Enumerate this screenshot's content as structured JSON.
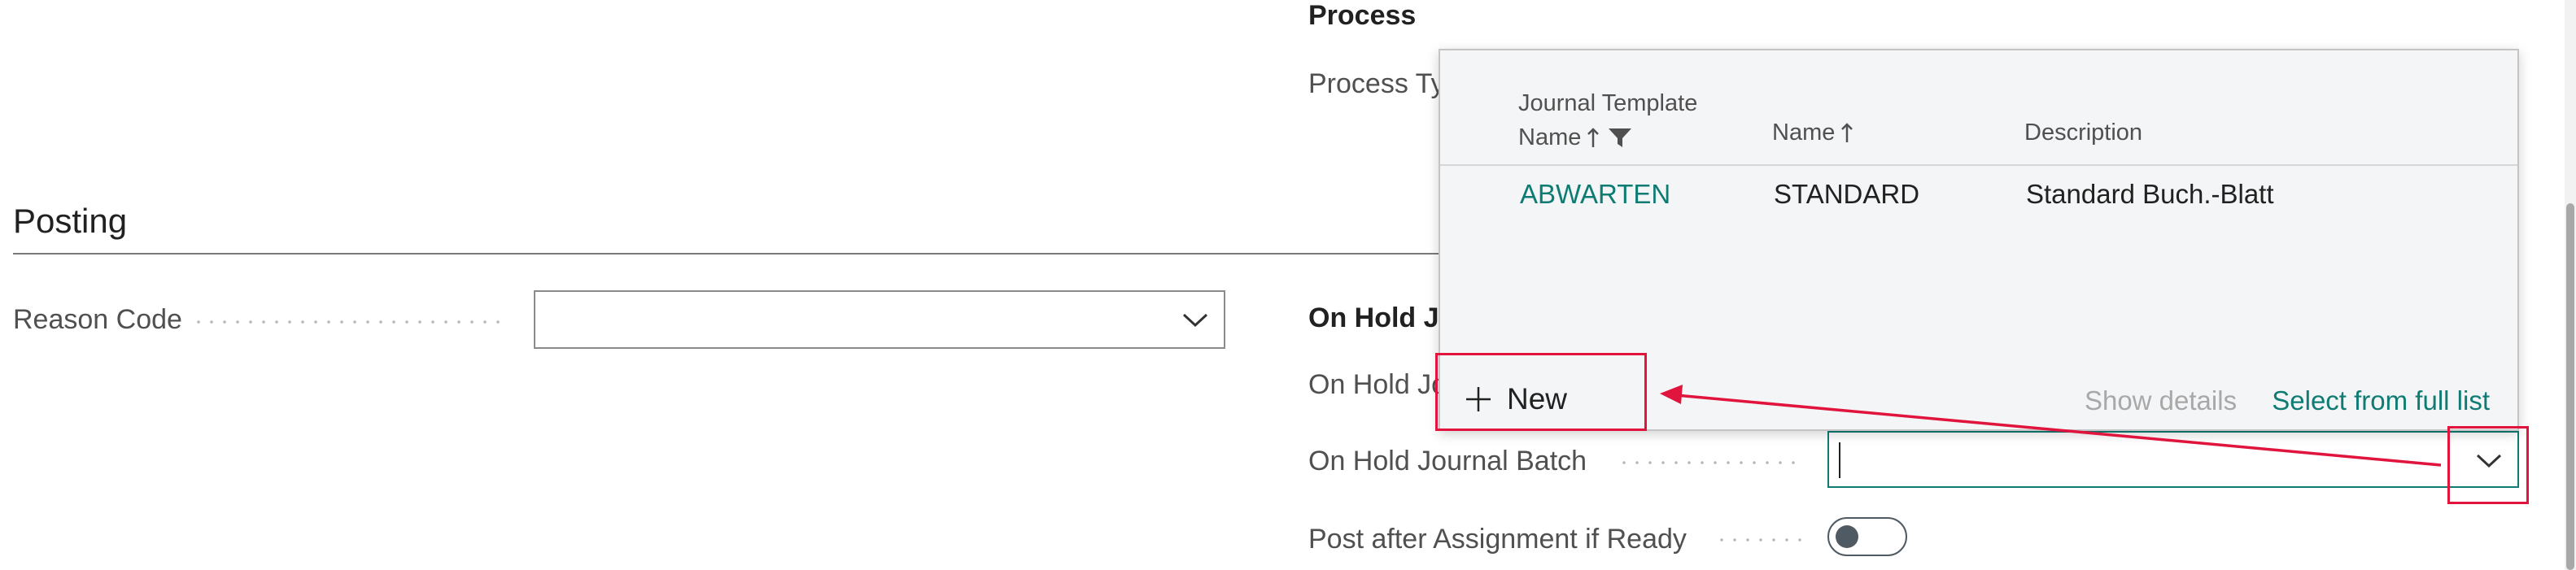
{
  "process": {
    "heading": "Process",
    "process_type_label": "Process Ty"
  },
  "posting": {
    "heading": "Posting",
    "reason_code_label": "Reason Code",
    "reason_code_value": ""
  },
  "on_hold": {
    "heading": "On Hold Jo",
    "template_label": "On Hold Jo",
    "batch_label": "On Hold Journal Batch",
    "batch_value": "",
    "post_after_label": "Post after Assignment if Ready",
    "post_after_on": false
  },
  "lookup": {
    "columns": {
      "template_line1": "Journal Template",
      "template_line2": "Name",
      "name": "Name",
      "description": "Description"
    },
    "rows": [
      {
        "template": "ABWARTEN",
        "name": "STANDARD",
        "description": "Standard Buch.-Blatt"
      }
    ],
    "new_label": "New",
    "show_details_label": "Show details",
    "select_full_list_label": "Select from full list"
  },
  "colors": {
    "accent": "#0f7c73",
    "annotation_red": "#e0143c",
    "toggle_knob": "#505a63"
  },
  "icons": [
    "chevron-down-icon",
    "sort-ascending-icon",
    "filter-icon",
    "plus-icon"
  ]
}
